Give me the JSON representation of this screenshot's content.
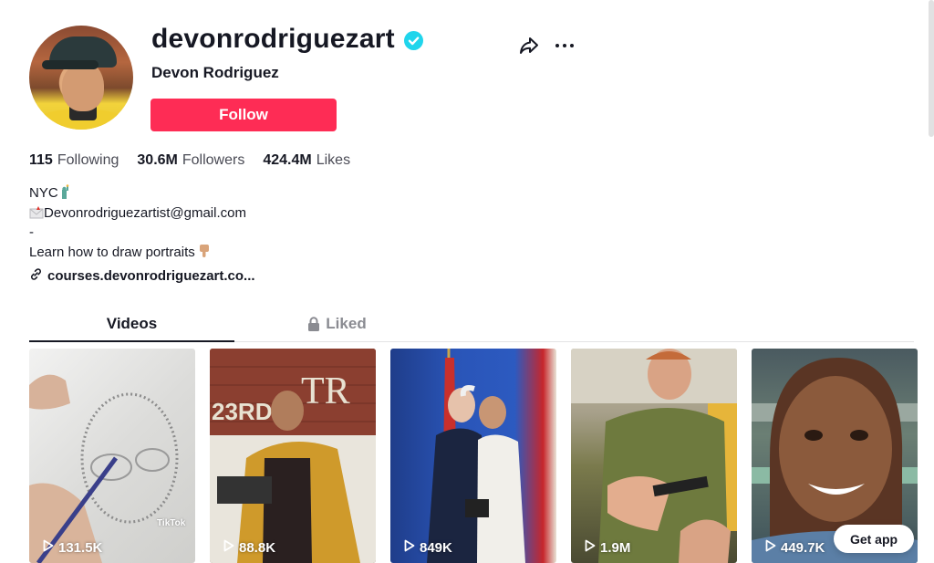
{
  "profile": {
    "username": "devonrodriguezart",
    "nickname": "Devon Rodriguez",
    "follow_label": "Follow"
  },
  "stats": [
    {
      "count": "115",
      "label": "Following"
    },
    {
      "count": "30.6M",
      "label": "Followers"
    },
    {
      "count": "424.4M",
      "label": "Likes"
    }
  ],
  "bio": {
    "line1": "NYC",
    "line2": "Devonrodriguezartist@gmail.com",
    "line3": "-",
    "line4": "Learn how to draw portraits"
  },
  "link": "courses.devonrodriguezart.co...",
  "tabs": {
    "videos": "Videos",
    "liked": "Liked"
  },
  "videos": [
    {
      "views": "131.5K"
    },
    {
      "views": "88.8K"
    },
    {
      "views": "849K"
    },
    {
      "views": "1.9M"
    },
    {
      "views": "449.7K"
    }
  ],
  "watermark": "TikTok",
  "get_app": "Get app",
  "colors": {
    "follow_bg": "#fe2c55",
    "verified": "#20d5ec",
    "text": "#161823"
  }
}
